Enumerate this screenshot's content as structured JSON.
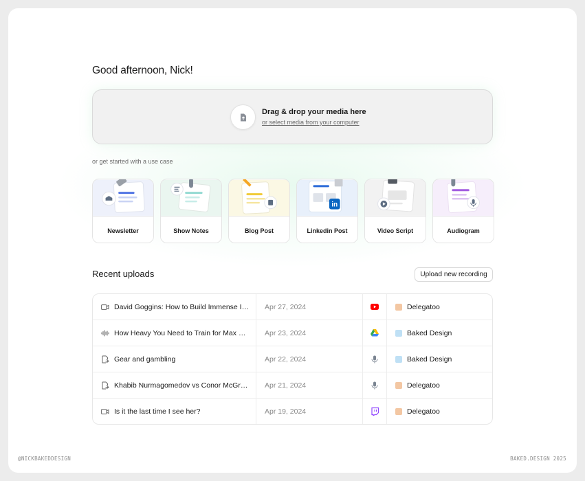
{
  "greeting": "Good afternoon, Nick!",
  "dropzone": {
    "title": "Drag & drop your media here",
    "subtitle": "or select media from your computer",
    "icon": "file-upload-icon"
  },
  "use_cases": {
    "caption": "or get started with a use case",
    "items": [
      {
        "label": "Newsletter",
        "bg": "#eef1fb"
      },
      {
        "label": "Show Notes",
        "bg": "#eaf6f0"
      },
      {
        "label": "Blog Post",
        "bg": "#fbf8e4"
      },
      {
        "label": "Linkedin Post",
        "bg": "#e8f0fb"
      },
      {
        "label": "Video Script",
        "bg": "#f2f2f2"
      },
      {
        "label": "Audiogram",
        "bg": "#f6eefb"
      }
    ]
  },
  "recent": {
    "title": "Recent uploads",
    "upload_button": "Upload new recording",
    "rows": [
      {
        "title": "David Goggins: How to Build Immense Inne...",
        "date": "Apr 27, 2024",
        "type_icon": "video-icon",
        "source_icon": "youtube-icon",
        "workspace": "Delegatoo",
        "ws_color": "#f3c7a3"
      },
      {
        "title": "How Heavy You Need to Train for Max Mus...",
        "date": "Apr 23, 2024",
        "type_icon": "audio-wave-icon",
        "source_icon": "google-drive-icon",
        "workspace": "Baked Design",
        "ws_color": "#bfe0f5"
      },
      {
        "title": "Gear and gambling",
        "date": "Apr 22, 2024",
        "type_icon": "upload-file-icon",
        "source_icon": "microphone-icon",
        "workspace": "Baked Design",
        "ws_color": "#bfe0f5"
      },
      {
        "title": "Khabib Nurmagomedov vs Conor McGregor",
        "date": "Apr 21, 2024",
        "type_icon": "upload-file-icon",
        "source_icon": "microphone-icon",
        "workspace": "Delegatoo",
        "ws_color": "#f3c7a3"
      },
      {
        "title": "Is it the last time I see her?",
        "date": "Apr 19, 2024",
        "type_icon": "video-icon",
        "source_icon": "twitch-icon",
        "workspace": "Delegatoo",
        "ws_color": "#f3c7a3"
      }
    ]
  },
  "footer": {
    "left": "@NICKBAKEDDESIGN",
    "right": "BAKED.DESIGN 2025"
  }
}
